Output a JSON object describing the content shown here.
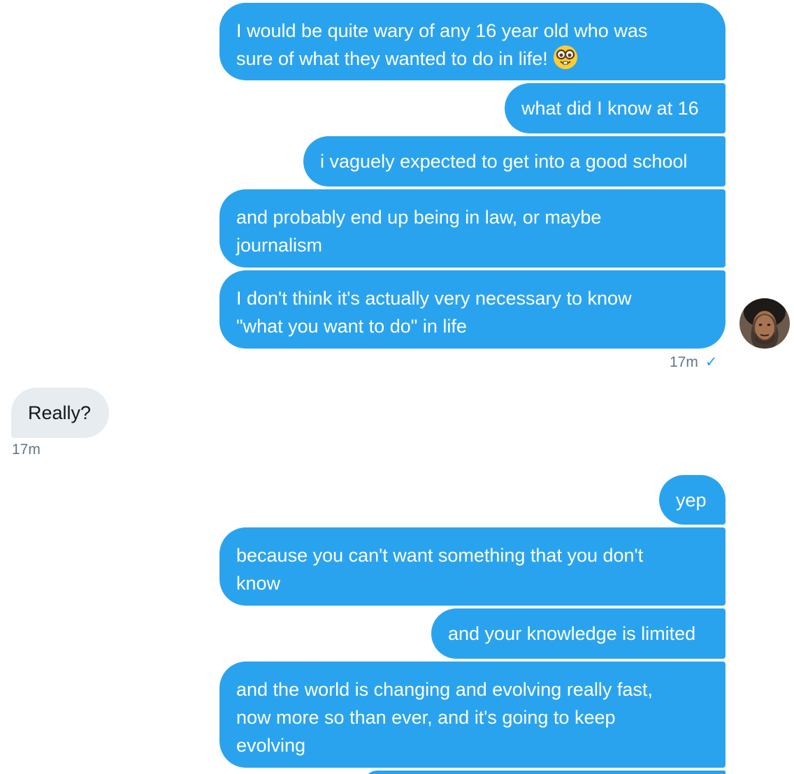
{
  "conversation": {
    "group1": {
      "messages": [
        {
          "line1": "I would be quite wary of any 16 year old who was",
          "line2": "sure of what they wanted to do in life!"
        },
        {
          "text": "what did I know at 16"
        },
        {
          "text": "i vaguely expected to get into a good school"
        },
        {
          "line1": "and probably end up being in law, or maybe",
          "line2": "journalism"
        },
        {
          "line1": "I don't think it's actually very necessary to know",
          "line2": "\"what you want to do\" in life"
        }
      ],
      "timestamp": "17m",
      "read_mark": "✓",
      "emoji_icon": "nerd-face-emoji"
    },
    "incoming": {
      "text": "Really?",
      "timestamp": "17m"
    },
    "group2": {
      "messages": [
        {
          "text": "yep"
        },
        {
          "line1": "because you can't want something that you don't",
          "line2": "know"
        },
        {
          "text": "and your knowledge is limited"
        },
        {
          "line1": "and the world is changing and evolving really fast,",
          "line2": "now more so than ever, and it's going to keep",
          "line3": "evolving"
        }
      ]
    }
  },
  "colors": {
    "outgoing_bubble": "#2aa3ef",
    "incoming_bubble": "#e6ecf0",
    "timestamp_text": "#657786",
    "read_check": "#1da1f2"
  }
}
